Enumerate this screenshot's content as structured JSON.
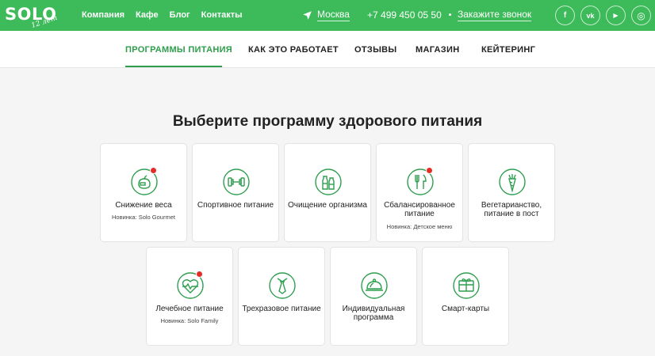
{
  "header": {
    "logo_text": "SOLO",
    "logo_script": "12 лет",
    "nav": [
      "Компания",
      "Кафе",
      "Блог",
      "Контакты"
    ],
    "city": "Москва",
    "phone": "+7 499 450 05 50",
    "callback": "Закажите звонок",
    "socials": [
      {
        "icon": "facebook-icon",
        "glyph": "f"
      },
      {
        "icon": "vk-icon",
        "glyph": "vk"
      },
      {
        "icon": "youtube-icon",
        "glyph": "▶"
      },
      {
        "icon": "instagram-icon",
        "glyph": "◎"
      }
    ]
  },
  "subnav": {
    "items": [
      "ПРОГРАММЫ ПИТАНИЯ",
      "КАК ЭТО РАБОТАЕТ",
      "ОТЗЫВЫ",
      "МАГАЗИН",
      "КЕЙТЕРИНГ"
    ],
    "active": "ПРОГРАММЫ ПИТАНИЯ"
  },
  "main": {
    "heading": "Выберите программу здорового питания",
    "programs": [
      {
        "title": "Снижение веса",
        "sub": "Новинка: Solo Gourmet",
        "icon": "scale-apple-icon",
        "badge": true
      },
      {
        "title": "Спортивное питание",
        "sub": "",
        "icon": "dumbbell-icon",
        "badge": false
      },
      {
        "title": "Очищение организма",
        "sub": "",
        "icon": "bottles-icon",
        "badge": false
      },
      {
        "title": "Сбалансированное питание",
        "sub": "Новинка: Детское меню",
        "icon": "fork-knife-icon",
        "badge": true
      },
      {
        "title": "Вегетарианство, питание в пост",
        "sub": "",
        "icon": "carrot-icon",
        "badge": false
      },
      {
        "title": "Лечебное питание",
        "sub": "Новинка: Solo Family",
        "icon": "heart-pulse-icon",
        "badge": true
      },
      {
        "title": "Трехразовое питание",
        "sub": "",
        "icon": "tie-icon",
        "badge": false
      },
      {
        "title": "Индивидуальная программа",
        "sub": "",
        "icon": "cloche-icon",
        "badge": false
      },
      {
        "title": "Смарт-карты",
        "sub": "",
        "icon": "gift-card-icon",
        "badge": false
      }
    ]
  },
  "colors": {
    "brand_green": "#3dba5a",
    "active_green": "#2e9e4c",
    "badge_red": "#e52d27",
    "icon_green": "#2f9e4f"
  }
}
